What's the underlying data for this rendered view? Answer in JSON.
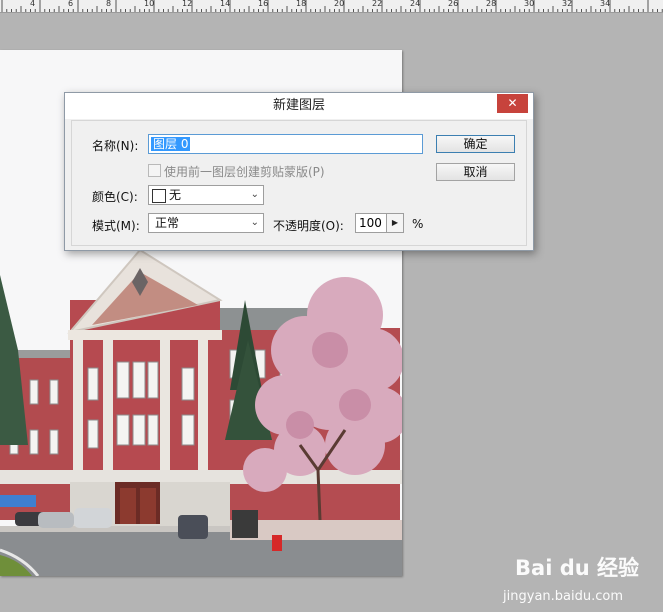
{
  "ruler": {
    "labels": [
      "4",
      "6",
      "8",
      "10",
      "12",
      "14",
      "16",
      "18",
      "20",
      "22",
      "24",
      "26",
      "28",
      "30",
      "32",
      "34"
    ]
  },
  "dialog": {
    "title": "新建图层",
    "close_icon": "close-icon",
    "name_label": "名称(N):",
    "name_value": "图层 0",
    "clip_checkbox_label": "使用前一图层创建剪贴蒙版(P)",
    "color_label": "颜色(C):",
    "color_value": "无",
    "mode_label": "模式(M):",
    "mode_value": "正常",
    "opacity_label": "不透明度(O):",
    "opacity_value": "100",
    "opacity_unit": "%",
    "ok_label": "确定",
    "cancel_label": "取消"
  },
  "watermark": {
    "brand": "Bai du 经验",
    "url": "jingyan.baidu.com"
  },
  "colors": {
    "close_red": "#c7433c",
    "selection_blue": "#3399ff",
    "workspace": "#b4b4b4"
  }
}
